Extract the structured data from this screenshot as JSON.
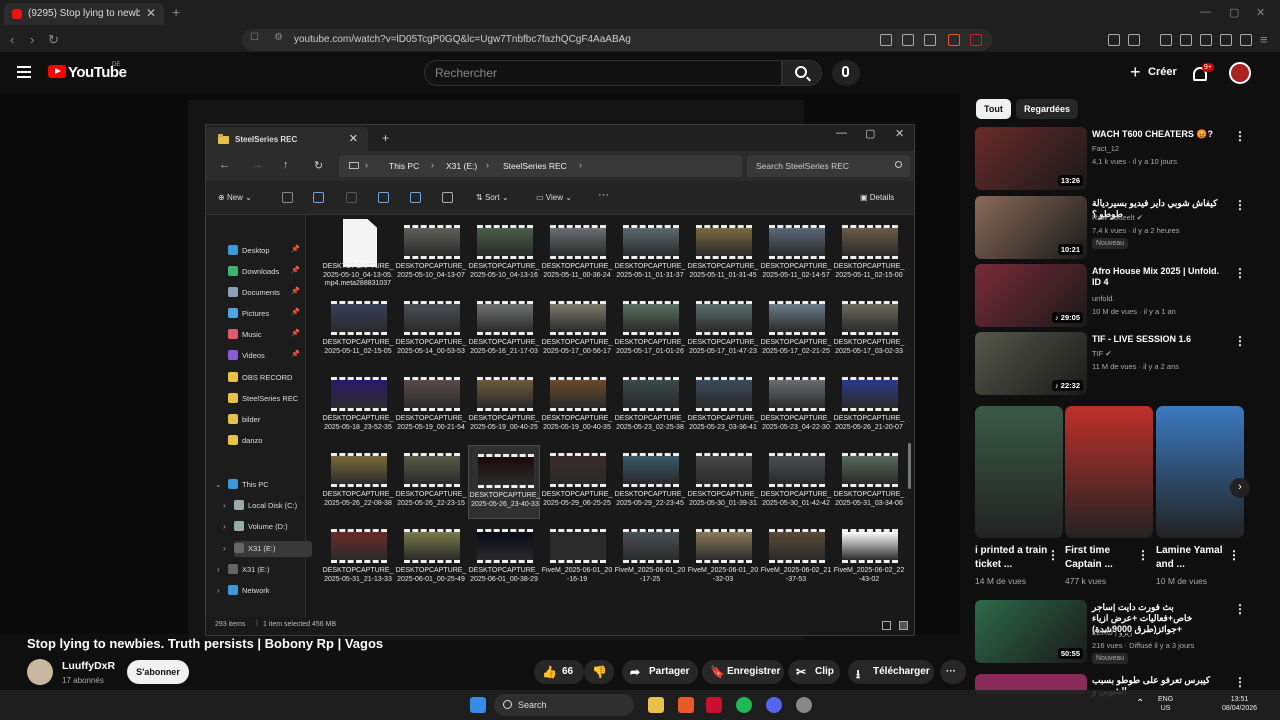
{
  "browser": {
    "tab_title": "(9295) Stop lying to newbies. Tru",
    "url": "youtube.com/watch?v=lD05TcgP0GQ&lc=Ugw7Tnbfbc7fazhQCgF4AaABAg"
  },
  "youtube": {
    "logo_text": "YouTube",
    "country": "DE",
    "search_placeholder": "Rechercher",
    "create_label": "Créer",
    "notif_count": "9+"
  },
  "explorer": {
    "tab_title": "SteelSeries REC",
    "breadcrumb": [
      "This PC",
      "X31 (E:)",
      "SteelSeries REC"
    ],
    "search_placeholder": "Search SteelSeries REC",
    "commands": {
      "new": "New",
      "sort": "Sort",
      "view": "View",
      "details": "Details"
    },
    "sidebar": [
      {
        "label": "Desktop",
        "pinned": "📌",
        "color": "#3a9ad9"
      },
      {
        "label": "Downloads",
        "pinned": "📌",
        "color": "#3cb371"
      },
      {
        "label": "Documents",
        "pinned": "📌",
        "color": "#8aa0b8"
      },
      {
        "label": "Pictures",
        "pinned": "📌",
        "color": "#4fa3e0"
      },
      {
        "label": "Music",
        "pinned": "📌",
        "color": "#e05a6a"
      },
      {
        "label": "Videos",
        "pinned": "📌",
        "color": "#8a5ad9"
      },
      {
        "label": "OBS RECORD",
        "pinned": "",
        "color": "#e8c14a"
      },
      {
        "label": "SteelSeries REC",
        "pinned": "",
        "color": "#e8c14a"
      },
      {
        "label": "bilder",
        "pinned": "",
        "color": "#e8c14a"
      },
      {
        "label": "danzo",
        "pinned": "",
        "color": "#e8c14a"
      }
    ],
    "tree": [
      {
        "label": "This PC",
        "color": "#3a9ad9"
      },
      {
        "label": "Local Disk (C:)",
        "color": "#9aa"
      },
      {
        "label": "Volume (D:)",
        "color": "#9aa"
      },
      {
        "label": "X31 (E:)",
        "color": "#666"
      },
      {
        "label": "X31 (E:)",
        "color": "#666"
      },
      {
        "label": "Network",
        "color": "#3a9ad9"
      }
    ],
    "files": [
      "DESKTOPCAPTURE_2025-05-10_04-13-05.mp4.meta288831037",
      "DESKTOPCAPTURE_2025-05-10_04-13-07",
      "DESKTOPCAPTURE_2025-05-10_04-13-16",
      "DESKTOPCAPTURE_2025-05-11_00-36-24",
      "DESKTOPCAPTURE_2025-05-11_01-31-37",
      "DESKTOPCAPTURE_2025-05-11_01-31-45",
      "DESKTOPCAPTURE_2025-05-11_02-14-57",
      "DESKTOPCAPTURE_2025-05-11_02-15-00",
      "DESKTOPCAPTURE_2025-05-11_02-15-05",
      "DESKTOPCAPTURE_2025-05-14_00-53-53",
      "DESKTOPCAPTURE_2025-05-16_21-17-03",
      "DESKTOPCAPTURE_2025-05-17_00-56-17",
      "DESKTOPCAPTURE_2025-05-17_01-01-26",
      "DESKTOPCAPTURE_2025-05-17_01-47-23",
      "DESKTOPCAPTURE_2025-05-17_02-21-25",
      "DESKTOPCAPTURE_2025-05-17_03-02-33",
      "DESKTOPCAPTURE_2025-05-18_23-52-35",
      "DESKTOPCAPTURE_2025-05-19_00-21-54",
      "DESKTOPCAPTURE_2025-05-19_00-40-25",
      "DESKTOPCAPTURE_2025-05-19_00-40-35",
      "DESKTOPCAPTURE_2025-05-23_02-25-38",
      "DESKTOPCAPTURE_2025-05-23_03-36-41",
      "DESKTOPCAPTURE_2025-05-23_04-22-30",
      "DESKTOPCAPTURE_2025-05-26_21-20-07",
      "DESKTOPCAPTURE_2025-05-26_22-08-38",
      "DESKTOPCAPTURE_2025-05-26_22-23-15",
      "DESKTOPCAPTURE_2025-05-26_23-40-33",
      "DESKTOPCAPTURE_2025-05-29_06-25-25",
      "DESKTOPCAPTURE_2025-05-29_22-23-45",
      "DESKTOPCAPTURE_2025-05-30_01-39-31",
      "DESKTOPCAPTURE_2025-05-30_01-42-42",
      "DESKTOPCAPTURE_2025-05-31_03-34-06",
      "DESKTOPCAPTURE_2025-05-31_21-13-33",
      "DESKTOPCAPTURE_2025-06-01_00-25-49",
      "DESKTOPCAPTURE_2025-06-01_00-38-29",
      "FiveM_2025-06-01_20-16-19",
      "FiveM_2025-06-01_20-17-25",
      "FiveM_2025-06-01_20-32-03",
      "FiveM_2025-06-02_21-37-53",
      "FiveM_2025-06-02_22-43-02"
    ],
    "status_items": "293 items",
    "status_selected": "1 item selected  456 MB"
  },
  "video": {
    "title": "Stop lying to newbies. Truth persists | Bobony Rp | Vagos",
    "channel": "LuuffyDxR",
    "subscribers": "17 abonnés",
    "subscribe_label": "S'abonner",
    "likes": "66",
    "share": "Partager",
    "save": "Enregistrer",
    "clip": "Clip",
    "download": "Télécharger"
  },
  "sidebar": {
    "chips": [
      "Tout",
      "Regardées"
    ],
    "videos": [
      {
        "title": "WACH T600 CHEATERS 😡?",
        "channel": "Fact_12",
        "meta": "4,1 k vues · il y a 10 jours",
        "duration": "13:26",
        "badge": "",
        "thumb": "#6a2a2a"
      },
      {
        "title": "كيفاش شوبي داير فيديو بسيرديالة طوطو ؟",
        "channel": "Raw Soueelt ✔",
        "meta": "7,4 k vues · il y a 2 heures",
        "duration": "10:21",
        "badge": "Nouveau",
        "thumb": "#8a6a5a"
      },
      {
        "title": "Afro House Mix 2025 | Unfold. ID 4",
        "channel": "unfold.",
        "meta": "10 M de vues · il y a 1 an",
        "duration": "♪ 29:05",
        "badge": "",
        "thumb": "#7a2a38"
      },
      {
        "title": "TIF - LIVE SESSION 1.6",
        "channel": "TIF ✔",
        "meta": "11 M de vues · il y a 2 ans",
        "duration": "♪ 22:32",
        "badge": "",
        "thumb": "#55584a"
      },
      {
        "title": "بث فورت دايت |ساجر خاص+فعاليات +عرض ازياء +جوائز(طرق 9000شدة)",
        "channel": "ZERO | زيرو",
        "meta": "216 vues · Diffusé il y a 3 jours",
        "duration": "50:55",
        "badge": "Nouveau",
        "thumb": "#2d6a4a"
      }
    ],
    "last_title": "كيبرس تعرفو على طوطو بسبب الشوبي و",
    "shorts": [
      {
        "title": "i printed a train ticket ...",
        "views": "14 M de vues",
        "thumb": "#3a5a45"
      },
      {
        "title": "First time Captain ...",
        "views": "477 k vues",
        "thumb": "#c0302a"
      },
      {
        "title": "Lamine Yamal and ...",
        "views": "10 M de vues",
        "thumb": "#3a7ac0"
      }
    ]
  },
  "taskbar": {
    "search": "Search",
    "lang": "ENG",
    "region": "US",
    "time": "13:51",
    "date": "08/04/2026"
  },
  "thumb_colors": [
    "#6b6a5e",
    "#5d6058",
    "#4a5f4a",
    "#6a6f73",
    "#5a6a6e",
    "#7a6a40",
    "#5a6878",
    "#6a5a48",
    "#3a3f5a",
    "#4a4e55",
    "#6f7070",
    "#7a7a6a",
    "#5a7060",
    "#5c6e6a",
    "#6a7c88",
    "#6a6a5a",
    "#2a1a6a",
    "#5a4a4a",
    "#6a5a3a",
    "#6a4a2a",
    "#3a4a4a",
    "#3a4a5a",
    "#6a6e72",
    "#2a3a8a",
    "#7a6a3a",
    "#5a5a48",
    "#1a0a0a",
    "#3a2a2a",
    "#3a5a6a",
    "#4a4a4a",
    "#4a4e52",
    "#5a6a5a",
    "#6a2a2a",
    "#7a7a4a",
    "#0a0a1a",
    "#2a2a2a",
    "#4a5058",
    "#8a7a5a",
    "#5a4a38",
    "#ffffff"
  ]
}
